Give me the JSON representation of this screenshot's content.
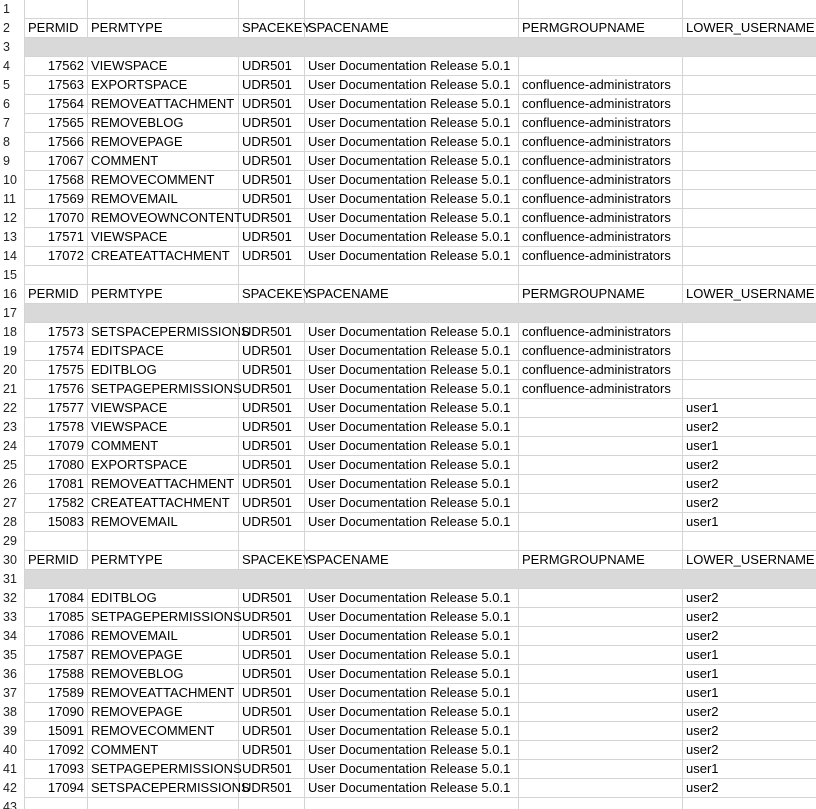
{
  "sheet": {
    "rows": [
      {
        "n": "1",
        "kind": "blank"
      },
      {
        "n": "2",
        "kind": "header",
        "cells": [
          "PERMID",
          "PERMTYPE",
          "SPACEKEY",
          "SPACENAME",
          "PERMGROUPNAME",
          "LOWER_USERNAME"
        ]
      },
      {
        "n": "3",
        "kind": "shaded"
      },
      {
        "n": "4",
        "cells": [
          "17562",
          "VIEWSPACE",
          "UDR501",
          "User Documentation Release 5.0.1",
          "",
          ""
        ]
      },
      {
        "n": "5",
        "cells": [
          "17563",
          "EXPORTSPACE",
          "UDR501",
          "User Documentation Release 5.0.1",
          "confluence-administrators",
          ""
        ]
      },
      {
        "n": "6",
        "cells": [
          "17564",
          "REMOVEATTACHMENT",
          "UDR501",
          "User Documentation Release 5.0.1",
          "confluence-administrators",
          ""
        ]
      },
      {
        "n": "7",
        "cells": [
          "17565",
          "REMOVEBLOG",
          "UDR501",
          "User Documentation Release 5.0.1",
          "confluence-administrators",
          ""
        ]
      },
      {
        "n": "8",
        "cells": [
          "17566",
          "REMOVEPAGE",
          "UDR501",
          "User Documentation Release 5.0.1",
          "confluence-administrators",
          ""
        ]
      },
      {
        "n": "9",
        "cells": [
          "17067",
          "COMMENT",
          "UDR501",
          "User Documentation Release 5.0.1",
          "confluence-administrators",
          ""
        ]
      },
      {
        "n": "10",
        "cells": [
          "17568",
          "REMOVECOMMENT",
          "UDR501",
          "User Documentation Release 5.0.1",
          "confluence-administrators",
          ""
        ]
      },
      {
        "n": "11",
        "cells": [
          "17569",
          "REMOVEMAIL",
          "UDR501",
          "User Documentation Release 5.0.1",
          "confluence-administrators",
          ""
        ]
      },
      {
        "n": "12",
        "cells": [
          "17070",
          "REMOVEOWNCONTENT",
          "UDR501",
          "User Documentation Release 5.0.1",
          "confluence-administrators",
          ""
        ]
      },
      {
        "n": "13",
        "cells": [
          "17571",
          "VIEWSPACE",
          "UDR501",
          "User Documentation Release 5.0.1",
          "confluence-administrators",
          ""
        ]
      },
      {
        "n": "14",
        "cells": [
          "17072",
          "CREATEATTACHMENT",
          "UDR501",
          "User Documentation Release 5.0.1",
          "confluence-administrators",
          ""
        ]
      },
      {
        "n": "15",
        "kind": "blank"
      },
      {
        "n": "16",
        "kind": "header",
        "cells": [
          "PERMID",
          "PERMTYPE",
          "SPACEKEY",
          "SPACENAME",
          "PERMGROUPNAME",
          "LOWER_USERNAME"
        ]
      },
      {
        "n": "17",
        "kind": "shaded"
      },
      {
        "n": "18",
        "cells": [
          "17573",
          "SETSPACEPERMISSIONS",
          "UDR501",
          "User Documentation Release 5.0.1",
          "confluence-administrators",
          ""
        ]
      },
      {
        "n": "19",
        "cells": [
          "17574",
          "EDITSPACE",
          "UDR501",
          "User Documentation Release 5.0.1",
          "confluence-administrators",
          ""
        ]
      },
      {
        "n": "20",
        "cells": [
          "17575",
          "EDITBLOG",
          "UDR501",
          "User Documentation Release 5.0.1",
          "confluence-administrators",
          ""
        ]
      },
      {
        "n": "21",
        "cells": [
          "17576",
          "SETPAGEPERMISSIONS",
          "UDR501",
          "User Documentation Release 5.0.1",
          "confluence-administrators",
          ""
        ]
      },
      {
        "n": "22",
        "cells": [
          "17577",
          "VIEWSPACE",
          "UDR501",
          "User Documentation Release 5.0.1",
          "",
          "user1"
        ]
      },
      {
        "n": "23",
        "cells": [
          "17578",
          "VIEWSPACE",
          "UDR501",
          "User Documentation Release 5.0.1",
          "",
          "user2"
        ]
      },
      {
        "n": "24",
        "cells": [
          "17079",
          "COMMENT",
          "UDR501",
          "User Documentation Release 5.0.1",
          "",
          "user1"
        ]
      },
      {
        "n": "25",
        "cells": [
          "17080",
          "EXPORTSPACE",
          "UDR501",
          "User Documentation Release 5.0.1",
          "",
          "user2"
        ]
      },
      {
        "n": "26",
        "cells": [
          "17081",
          "REMOVEATTACHMENT",
          "UDR501",
          "User Documentation Release 5.0.1",
          "",
          "user2"
        ]
      },
      {
        "n": "27",
        "cells": [
          "17582",
          "CREATEATTACHMENT",
          "UDR501",
          "User Documentation Release 5.0.1",
          "",
          "user2"
        ]
      },
      {
        "n": "28",
        "cells": [
          "15083",
          "REMOVEMAIL",
          "UDR501",
          "User Documentation Release 5.0.1",
          "",
          "user1"
        ]
      },
      {
        "n": "29",
        "kind": "blank"
      },
      {
        "n": "30",
        "kind": "header",
        "cells": [
          "PERMID",
          "PERMTYPE",
          "SPACEKEY",
          "SPACENAME",
          "PERMGROUPNAME",
          "LOWER_USERNAME"
        ]
      },
      {
        "n": "31",
        "kind": "shaded"
      },
      {
        "n": "32",
        "cells": [
          "17084",
          "EDITBLOG",
          "UDR501",
          "User Documentation Release 5.0.1",
          "",
          "user2"
        ]
      },
      {
        "n": "33",
        "cells": [
          "17085",
          "SETPAGEPERMISSIONS",
          "UDR501",
          "User Documentation Release 5.0.1",
          "",
          "user2"
        ]
      },
      {
        "n": "34",
        "cells": [
          "17086",
          "REMOVEMAIL",
          "UDR501",
          "User Documentation Release 5.0.1",
          "",
          "user2"
        ]
      },
      {
        "n": "35",
        "cells": [
          "17587",
          "REMOVEPAGE",
          "UDR501",
          "User Documentation Release 5.0.1",
          "",
          "user1"
        ]
      },
      {
        "n": "36",
        "cells": [
          "17588",
          "REMOVEBLOG",
          "UDR501",
          "User Documentation Release 5.0.1",
          "",
          "user1"
        ]
      },
      {
        "n": "37",
        "cells": [
          "17589",
          "REMOVEATTACHMENT",
          "UDR501",
          "User Documentation Release 5.0.1",
          "",
          "user1"
        ]
      },
      {
        "n": "38",
        "cells": [
          "17090",
          "REMOVEPAGE",
          "UDR501",
          "User Documentation Release 5.0.1",
          "",
          "user2"
        ]
      },
      {
        "n": "39",
        "cells": [
          "15091",
          "REMOVECOMMENT",
          "UDR501",
          "User Documentation Release 5.0.1",
          "",
          "user2"
        ]
      },
      {
        "n": "40",
        "cells": [
          "17092",
          "COMMENT",
          "UDR501",
          "User Documentation Release 5.0.1",
          "",
          "user2"
        ]
      },
      {
        "n": "41",
        "cells": [
          "17093",
          "SETPAGEPERMISSIONS",
          "UDR501",
          "User Documentation Release 5.0.1",
          "",
          "user1"
        ]
      },
      {
        "n": "42",
        "cells": [
          "17094",
          "SETSPACEPERMISSIONS",
          "UDR501",
          "User Documentation Release 5.0.1",
          "",
          "user2"
        ]
      },
      {
        "n": "43",
        "kind": "blank"
      }
    ]
  },
  "colors": {
    "grid": "#d4d4d4",
    "shaded_row": "#d9d9d9",
    "text": "#000000"
  }
}
